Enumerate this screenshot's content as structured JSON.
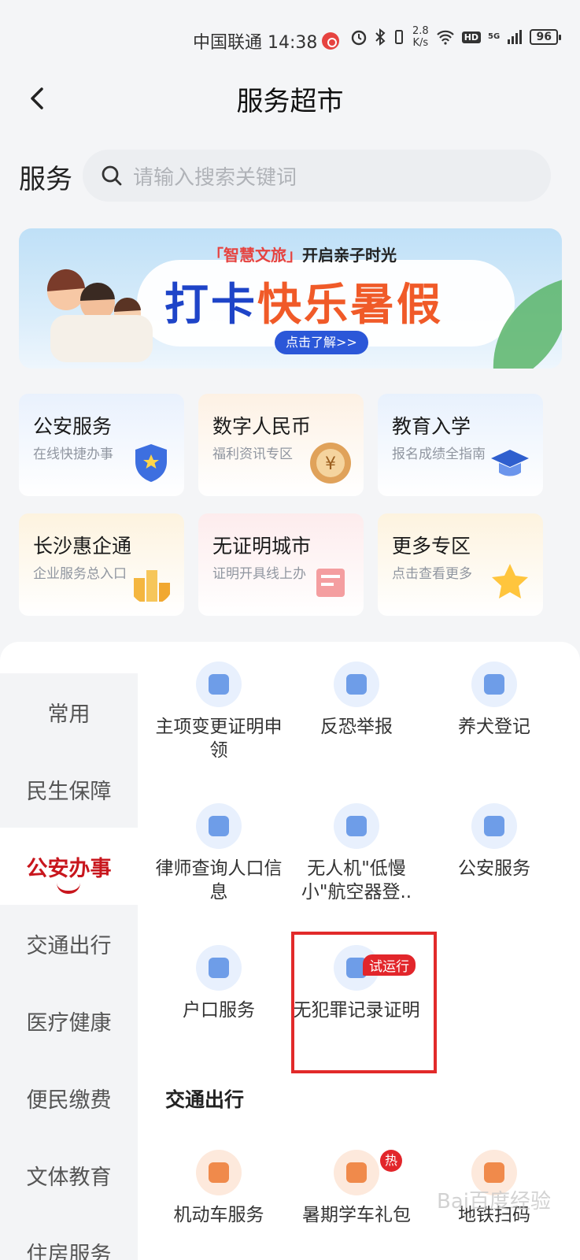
{
  "status_bar": {
    "carrier_time": "中国联通 14:38",
    "net_speed_value": "2.8",
    "net_speed_unit": "K/s",
    "hd": "HD",
    "network": "5G",
    "battery": "96"
  },
  "header": {
    "title": "服务超市"
  },
  "search": {
    "label": "服务",
    "placeholder": "请输入搜索关键词"
  },
  "banner": {
    "brand": "「智慧文旅」",
    "subtitle": "开启亲子时光",
    "headline_a": "打卡",
    "headline_b": "快乐暑假",
    "cta": "点击了解>>"
  },
  "cards": [
    {
      "title": "公安服务",
      "subtitle": "在线快捷办事"
    },
    {
      "title": "数字人民币",
      "subtitle": "福利资讯专区"
    },
    {
      "title": "教育入学",
      "subtitle": "报名成绩全指南"
    },
    {
      "title": "长沙惠企通",
      "subtitle": "企业服务总入口"
    },
    {
      "title": "无证明城市",
      "subtitle": "证明开具线上办"
    },
    {
      "title": "更多专区",
      "subtitle": "点击查看更多"
    }
  ],
  "sidebar": {
    "items": [
      {
        "label": "常用"
      },
      {
        "label": "民生保障"
      },
      {
        "label": "公安办事",
        "active": true
      },
      {
        "label": "交通出行"
      },
      {
        "label": "医疗健康"
      },
      {
        "label": "便民缴费"
      },
      {
        "label": "文体教育"
      },
      {
        "label": "住房服务"
      }
    ]
  },
  "services": [
    {
      "label": "主项变更证明申领"
    },
    {
      "label": "反恐举报"
    },
    {
      "label": "养犬登记"
    },
    {
      "label": "律师查询人口信息"
    },
    {
      "label": "无人机\"低慢小\"航空器登.."
    },
    {
      "label": "公安服务"
    },
    {
      "label": "户口服务"
    },
    {
      "label": "无犯罪记录证明",
      "badge": "试运行"
    }
  ],
  "section_transport": {
    "title": "交通出行",
    "items": [
      {
        "label": "机动车服务"
      },
      {
        "label": "暑期学车礼包",
        "badge": "热"
      },
      {
        "label": "地铁扫码"
      }
    ]
  },
  "watermark": "Bai百度经验"
}
